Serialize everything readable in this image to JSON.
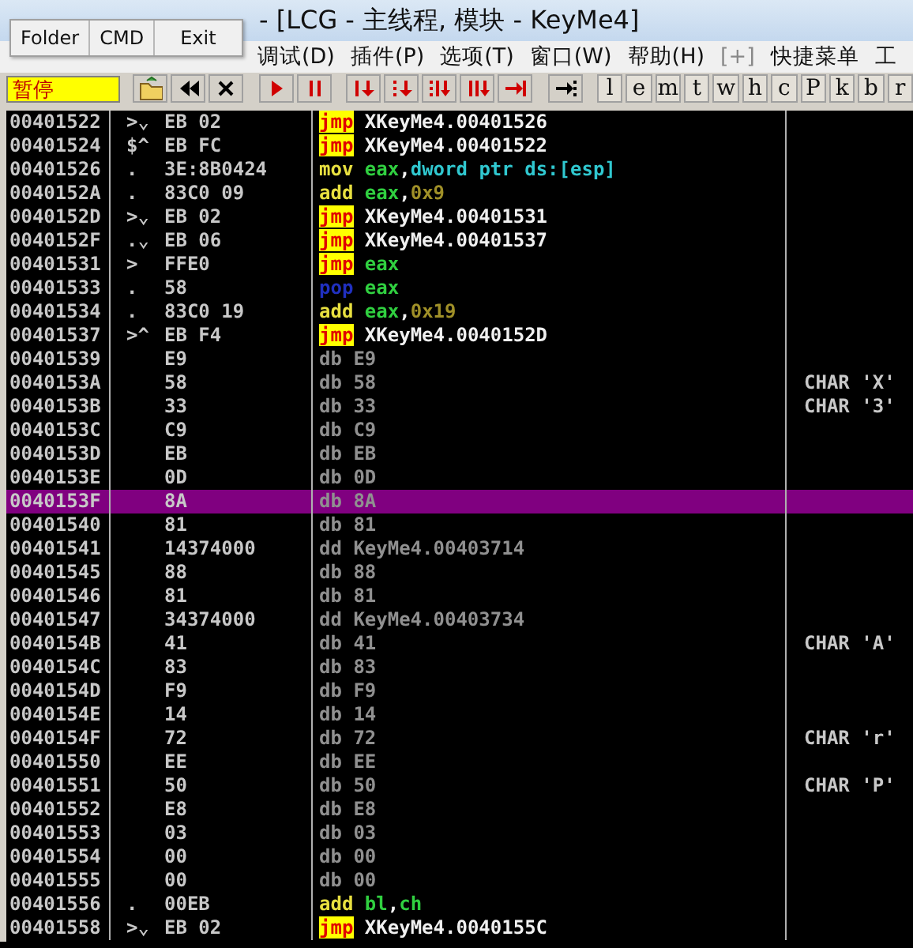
{
  "window": {
    "title": "- [LCG -  主线程, 模块 - KeyMe4]"
  },
  "popup_menu": [
    {
      "label": "Folder"
    },
    {
      "label": "CMD"
    },
    {
      "label": "Exit"
    }
  ],
  "menu": [
    {
      "label": "调试(D)",
      "disabled": false
    },
    {
      "label": "插件(P)",
      "disabled": false
    },
    {
      "label": "选项(T)",
      "disabled": false
    },
    {
      "label": "窗口(W)",
      "disabled": false
    },
    {
      "label": "帮助(H)",
      "disabled": false
    },
    {
      "label": "[+]",
      "disabled": true
    },
    {
      "label": "快捷菜单",
      "disabled": false
    },
    {
      "label": "工",
      "disabled": false
    }
  ],
  "toolbar": {
    "status": "暂停",
    "letter_buttons": [
      {
        "label": "l"
      },
      {
        "label": "e"
      },
      {
        "label": "m"
      },
      {
        "label": "t"
      },
      {
        "label": "w"
      },
      {
        "label": "h"
      },
      {
        "label": "c"
      },
      {
        "label": "P"
      },
      {
        "label": "k"
      },
      {
        "label": "b"
      },
      {
        "label": "r"
      }
    ]
  },
  "rows": [
    {
      "address": "00401522",
      "marker": ">⌄",
      "hex": "EB 02",
      "mnemonic": "jmp",
      "kind": "jump",
      "operands": [
        {
          "text": "XKeyMe4.00401526",
          "kind": "label"
        }
      ],
      "selected": false
    },
    {
      "address": "00401524",
      "marker": "$^",
      "hex": "EB FC",
      "mnemonic": "jmp",
      "kind": "jump",
      "operands": [
        {
          "text": "XKeyMe4.00401522",
          "kind": "label"
        }
      ],
      "selected": false
    },
    {
      "address": "00401526",
      "marker": ".",
      "hex": "3E:8B0424",
      "mnemonic": "mov",
      "kind": "arith",
      "operands": [
        {
          "text": "eax",
          "kind": "reg"
        },
        {
          "text": ",",
          "kind": "label"
        },
        {
          "text": "dword ptr ds:[esp]",
          "kind": "mem"
        }
      ],
      "selected": false
    },
    {
      "address": "0040152A",
      "marker": ".",
      "hex": "83C0 09",
      "mnemonic": "add",
      "kind": "arith",
      "operands": [
        {
          "text": "eax",
          "kind": "reg"
        },
        {
          "text": ",",
          "kind": "label"
        },
        {
          "text": "0x9",
          "kind": "num"
        }
      ],
      "selected": false
    },
    {
      "address": "0040152D",
      "marker": ">⌄",
      "hex": "EB 02",
      "mnemonic": "jmp",
      "kind": "jump",
      "operands": [
        {
          "text": "XKeyMe4.00401531",
          "kind": "label"
        }
      ],
      "selected": false
    },
    {
      "address": "0040152F",
      "marker": ".⌄",
      "hex": "EB 06",
      "mnemonic": "jmp",
      "kind": "jump",
      "operands": [
        {
          "text": "XKeyMe4.00401537",
          "kind": "label"
        }
      ],
      "selected": false
    },
    {
      "address": "00401531",
      "marker": ">",
      "hex": "FFE0",
      "mnemonic": "jmp",
      "kind": "jump",
      "operands": [
        {
          "text": "eax",
          "kind": "reg"
        }
      ],
      "selected": false
    },
    {
      "address": "00401533",
      "marker": ".",
      "hex": "58",
      "mnemonic": "pop",
      "kind": "stack",
      "operands": [
        {
          "text": "eax",
          "kind": "reg"
        }
      ],
      "selected": false
    },
    {
      "address": "00401534",
      "marker": ".",
      "hex": "83C0 19",
      "mnemonic": "add",
      "kind": "arith",
      "operands": [
        {
          "text": "eax",
          "kind": "reg"
        },
        {
          "text": ",",
          "kind": "label"
        },
        {
          "text": "0x19",
          "kind": "num"
        }
      ],
      "selected": false
    },
    {
      "address": "00401537",
      "marker": ">^",
      "hex": "EB F4",
      "mnemonic": "jmp",
      "kind": "jump",
      "operands": [
        {
          "text": "XKeyMe4.0040152D",
          "kind": "label"
        }
      ],
      "selected": false
    },
    {
      "address": "00401539",
      "hex": "E9",
      "mnemonic": "db",
      "kind": "data",
      "operands": [
        {
          "text": "E9",
          "kind": "data"
        }
      ],
      "selected": false
    },
    {
      "address": "0040153A",
      "hex": "58",
      "mnemonic": "db",
      "kind": "data",
      "operands": [
        {
          "text": "58",
          "kind": "data"
        }
      ],
      "comment": "CHAR 'X'",
      "selected": false
    },
    {
      "address": "0040153B",
      "hex": "33",
      "mnemonic": "db",
      "kind": "data",
      "operands": [
        {
          "text": "33",
          "kind": "data"
        }
      ],
      "comment": "CHAR '3'",
      "selected": false
    },
    {
      "address": "0040153C",
      "hex": "C9",
      "mnemonic": "db",
      "kind": "data",
      "operands": [
        {
          "text": "C9",
          "kind": "data"
        }
      ],
      "selected": false
    },
    {
      "address": "0040153D",
      "hex": "EB",
      "mnemonic": "db",
      "kind": "data",
      "operands": [
        {
          "text": "EB",
          "kind": "data"
        }
      ],
      "selected": false
    },
    {
      "address": "0040153E",
      "hex": "0D",
      "mnemonic": "db",
      "kind": "data",
      "operands": [
        {
          "text": "0D",
          "kind": "data"
        }
      ],
      "selected": false
    },
    {
      "address": "0040153F",
      "hex": "8A",
      "mnemonic": "db",
      "kind": "data",
      "operands": [
        {
          "text": "8A",
          "kind": "data"
        }
      ],
      "selected": true
    },
    {
      "address": "00401540",
      "hex": "81",
      "mnemonic": "db",
      "kind": "data",
      "operands": [
        {
          "text": "81",
          "kind": "data"
        }
      ],
      "selected": false
    },
    {
      "address": "00401541",
      "hex": "14374000",
      "mnemonic": "dd",
      "kind": "data",
      "operands": [
        {
          "text": "KeyMe4.00403714",
          "kind": "data"
        }
      ],
      "selected": false
    },
    {
      "address": "00401545",
      "hex": "88",
      "mnemonic": "db",
      "kind": "data",
      "operands": [
        {
          "text": "88",
          "kind": "data"
        }
      ],
      "selected": false
    },
    {
      "address": "00401546",
      "hex": "81",
      "mnemonic": "db",
      "kind": "data",
      "operands": [
        {
          "text": "81",
          "kind": "data"
        }
      ],
      "selected": false
    },
    {
      "address": "00401547",
      "hex": "34374000",
      "mnemonic": "dd",
      "kind": "data",
      "operands": [
        {
          "text": "KeyMe4.00403734",
          "kind": "data"
        }
      ],
      "selected": false
    },
    {
      "address": "0040154B",
      "hex": "41",
      "mnemonic": "db",
      "kind": "data",
      "operands": [
        {
          "text": "41",
          "kind": "data"
        }
      ],
      "comment": "CHAR 'A'",
      "selected": false
    },
    {
      "address": "0040154C",
      "hex": "83",
      "mnemonic": "db",
      "kind": "data",
      "operands": [
        {
          "text": "83",
          "kind": "data"
        }
      ],
      "selected": false
    },
    {
      "address": "0040154D",
      "hex": "F9",
      "mnemonic": "db",
      "kind": "data",
      "operands": [
        {
          "text": "F9",
          "kind": "data"
        }
      ],
      "selected": false
    },
    {
      "address": "0040154E",
      "hex": "14",
      "mnemonic": "db",
      "kind": "data",
      "operands": [
        {
          "text": "14",
          "kind": "data"
        }
      ],
      "selected": false
    },
    {
      "address": "0040154F",
      "hex": "72",
      "mnemonic": "db",
      "kind": "data",
      "operands": [
        {
          "text": "72",
          "kind": "data"
        }
      ],
      "comment": "CHAR 'r'",
      "selected": false
    },
    {
      "address": "00401550",
      "hex": "EE",
      "mnemonic": "db",
      "kind": "data",
      "operands": [
        {
          "text": "EE",
          "kind": "data"
        }
      ],
      "selected": false
    },
    {
      "address": "00401551",
      "hex": "50",
      "mnemonic": "db",
      "kind": "data",
      "operands": [
        {
          "text": "50",
          "kind": "data"
        }
      ],
      "comment": "CHAR 'P'",
      "selected": false
    },
    {
      "address": "00401552",
      "hex": "E8",
      "mnemonic": "db",
      "kind": "data",
      "operands": [
        {
          "text": "E8",
          "kind": "data"
        }
      ],
      "selected": false
    },
    {
      "address": "00401553",
      "hex": "03",
      "mnemonic": "db",
      "kind": "data",
      "operands": [
        {
          "text": "03",
          "kind": "data"
        }
      ],
      "selected": false
    },
    {
      "address": "00401554",
      "hex": "00",
      "mnemonic": "db",
      "kind": "data",
      "operands": [
        {
          "text": "00",
          "kind": "data"
        }
      ],
      "selected": false
    },
    {
      "address": "00401555",
      "hex": "00",
      "mnemonic": "db",
      "kind": "data",
      "operands": [
        {
          "text": "00",
          "kind": "data"
        }
      ],
      "selected": false
    },
    {
      "address": "00401556",
      "marker": ".",
      "hex": "00EB",
      "mnemonic": "add",
      "kind": "arith",
      "operands": [
        {
          "text": "bl",
          "kind": "reg"
        },
        {
          "text": ",",
          "kind": "label"
        },
        {
          "text": "ch",
          "kind": "reg"
        }
      ],
      "selected": false
    },
    {
      "address": "00401558",
      "marker": ">⌄",
      "hex": "EB 02",
      "mnemonic": "jmp",
      "kind": "jump",
      "operands": [
        {
          "text": "XKeyMe4.0040155C",
          "kind": "label"
        }
      ],
      "selected": false
    }
  ]
}
